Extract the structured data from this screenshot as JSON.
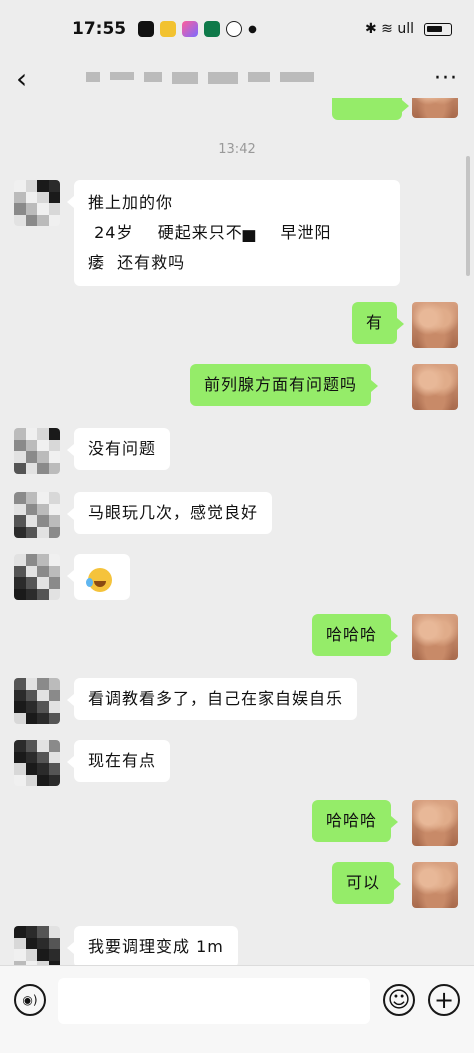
{
  "status_bar": {
    "time": "17:55",
    "signal_icons": "✱ ≋ ull",
    "battery": "battery-icon"
  },
  "nav": {
    "back_icon": "chevron-left-icon",
    "more_icon": "more-icon",
    "more_glyph": "···"
  },
  "chat": {
    "timestamp": "13:42",
    "messages": [
      {
        "side": "right",
        "text": "",
        "partial": true
      },
      {
        "side": "left",
        "text": "推上加的你\n 24岁    硬起来只不▅  早泄阳痿  还有救吗"
      },
      {
        "side": "right",
        "text": "有"
      },
      {
        "side": "right",
        "text": "前列腺方面有问题吗"
      },
      {
        "side": "left",
        "text": "没有问题"
      },
      {
        "side": "left",
        "text": "马眼玩几次，感觉良好"
      },
      {
        "side": "left",
        "text": "",
        "emoji": "laughing-crying-face-icon"
      },
      {
        "side": "right",
        "text": "哈哈哈"
      },
      {
        "side": "left",
        "text": "看调教看多了，自己在家自娱自乐"
      },
      {
        "side": "left",
        "text": "现在有点"
      },
      {
        "side": "right",
        "text": "哈哈哈"
      },
      {
        "side": "right",
        "text": "可以"
      },
      {
        "side": "left",
        "text": "我要调理变成 1m"
      }
    ],
    "line1": "推上加的你",
    "line2": " 24岁    硬起来只不▅    早泄阳",
    "line3": "痿  还有救吗",
    "m_you": "有",
    "m_prostate": "前列腺方面有问题吗",
    "m_noproblem": "没有问题",
    "m_mayan": "马眼玩几次，感觉良好",
    "m_haha1": "哈哈哈",
    "m_watch": "看调教看多了，自己在家自娱自乐",
    "m_now": "现在有点",
    "m_haha2": "哈哈哈",
    "m_ok": "可以",
    "m_last": "我要调理变成 1m"
  },
  "input_bar": {
    "voice_icon": "voice-icon",
    "voice_glyph": "◉)",
    "emoji_icon": "emoji-icon",
    "emoji_glyph": "☺",
    "plus_icon": "plus-icon",
    "plus_glyph": "+",
    "placeholder": ""
  },
  "colors": {
    "background": "#ededed",
    "sent_bubble": "#95ec69",
    "received_bubble": "#ffffff",
    "timestamp": "#999999"
  }
}
